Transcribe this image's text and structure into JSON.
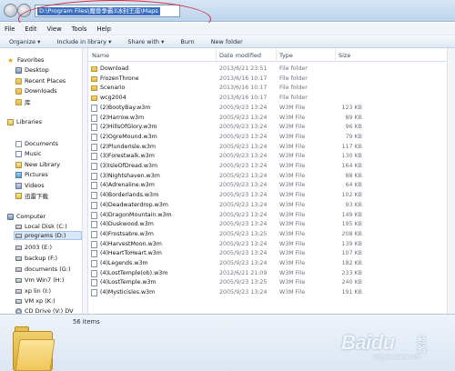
{
  "address": {
    "path": "D:\\Program Files\\魔兽争霸3冰封王座\\Maps"
  },
  "menu": [
    "File",
    "Edit",
    "View",
    "Tools",
    "Help"
  ],
  "toolbar": [
    "Organize ▾",
    "Include in library ▾",
    "Share with ▾",
    "Burn",
    "New folder"
  ],
  "nav": {
    "favorites": "Favorites",
    "fav_items": [
      "Desktop",
      "Recent Places",
      "Downloads",
      "库"
    ],
    "libraries": "Libraries",
    "lib_items": [
      "Documents",
      "Music",
      "New Library",
      "Pictures",
      "Videos",
      "迅雷下载"
    ],
    "computer": "Computer",
    "drives": [
      "Local Disk (C:)",
      "programs (D:)",
      "2003 (E:)",
      "backup (F:)",
      "documents (G:)",
      "Vm Win7 (H:)",
      "xp lin (I:)",
      "VM xp (K:)",
      "CD Drive (V:) DV"
    ]
  },
  "columns": {
    "name": "Name",
    "date": "Date modified",
    "type": "Type",
    "size": "Size"
  },
  "files": [
    {
      "name": "Download",
      "date": "2013/6/21 23:51",
      "type": "File folder",
      "size": "",
      "kind": "folder"
    },
    {
      "name": "FrozenThrone",
      "date": "2013/6/16 10:17",
      "type": "File folder",
      "size": "",
      "kind": "folder"
    },
    {
      "name": "Scenario",
      "date": "2013/6/16 10:17",
      "type": "File folder",
      "size": "",
      "kind": "folder"
    },
    {
      "name": "wcg2004",
      "date": "2013/6/16 10:17",
      "type": "File folder",
      "size": "",
      "kind": "folder"
    },
    {
      "name": "(2)BootyBay.w3m",
      "date": "2005/9/23 13:24",
      "type": "W3M File",
      "size": "123 KB",
      "kind": "file"
    },
    {
      "name": "(2)Harrow.w3m",
      "date": "2005/9/23 13:24",
      "type": "W3M File",
      "size": "89 KB",
      "kind": "file"
    },
    {
      "name": "(2)HillsOfGlory.w3m",
      "date": "2005/9/23 13:24",
      "type": "W3M File",
      "size": "96 KB",
      "kind": "file"
    },
    {
      "name": "(2)OgreMound.w3m",
      "date": "2005/9/23 13:24",
      "type": "W3M File",
      "size": "79 KB",
      "kind": "file"
    },
    {
      "name": "(2)PlunderIsle.w3m",
      "date": "2005/9/23 13:24",
      "type": "W3M File",
      "size": "117 KB",
      "kind": "file"
    },
    {
      "name": "(3)Forestwalk.w3m",
      "date": "2005/9/23 13:24",
      "type": "W3M File",
      "size": "130 KB",
      "kind": "file"
    },
    {
      "name": "(3)IsleOfDread.w3m",
      "date": "2005/9/23 13:24",
      "type": "W3M File",
      "size": "164 KB",
      "kind": "file"
    },
    {
      "name": "(3)Nightshaven.w3m",
      "date": "2005/9/23 13:24",
      "type": "W3M File",
      "size": "88 KB",
      "kind": "file"
    },
    {
      "name": "(4)Adrenaline.w3m",
      "date": "2005/9/23 13:24",
      "type": "W3M File",
      "size": "64 KB",
      "kind": "file"
    },
    {
      "name": "(4)Borderlands.w3m",
      "date": "2005/9/23 13:24",
      "type": "W3M File",
      "size": "102 KB",
      "kind": "file"
    },
    {
      "name": "(4)Deadwaterdrop.w3m",
      "date": "2005/9/23 13:24",
      "type": "W3M File",
      "size": "93 KB",
      "kind": "file"
    },
    {
      "name": "(4)DragonMountain.w3m",
      "date": "2005/9/23 13:24",
      "type": "W3M File",
      "size": "149 KB",
      "kind": "file"
    },
    {
      "name": "(4)Duskwood.w3m",
      "date": "2005/9/23 13:24",
      "type": "W3M File",
      "size": "195 KB",
      "kind": "file"
    },
    {
      "name": "(4)Frostsabre.w3m",
      "date": "2005/9/23 13:25",
      "type": "W3M File",
      "size": "208 KB",
      "kind": "file"
    },
    {
      "name": "(4)HarvestMoon.w3m",
      "date": "2005/9/23 13:24",
      "type": "W3M File",
      "size": "139 KB",
      "kind": "file"
    },
    {
      "name": "(4)HeartToHeart.w3m",
      "date": "2005/9/23 13:24",
      "type": "W3M File",
      "size": "107 KB",
      "kind": "file"
    },
    {
      "name": "(4)Legends.w3m",
      "date": "2005/9/23 13:24",
      "type": "W3M File",
      "size": "182 KB",
      "kind": "file"
    },
    {
      "name": "(4)LostTemple(ob).w3m",
      "date": "2012/6/21 21:09",
      "type": "W3M File",
      "size": "233 KB",
      "kind": "file"
    },
    {
      "name": "(4)LostTemple.w3m",
      "date": "2005/9/23 13:25",
      "type": "W3M File",
      "size": "240 KB",
      "kind": "file"
    },
    {
      "name": "(4)Mysticisles.w3m",
      "date": "2005/9/23 13:24",
      "type": "W3M File",
      "size": "191 KB",
      "kind": "file"
    }
  ],
  "details": {
    "count": "56 items"
  },
  "watermark": {
    "text": "Baidu",
    "cn": [
      "经",
      "验"
    ],
    "url": "jingyan.baidu.com"
  },
  "colors": {
    "annotation": "#d7283a",
    "selection": "#3a6fbf"
  }
}
